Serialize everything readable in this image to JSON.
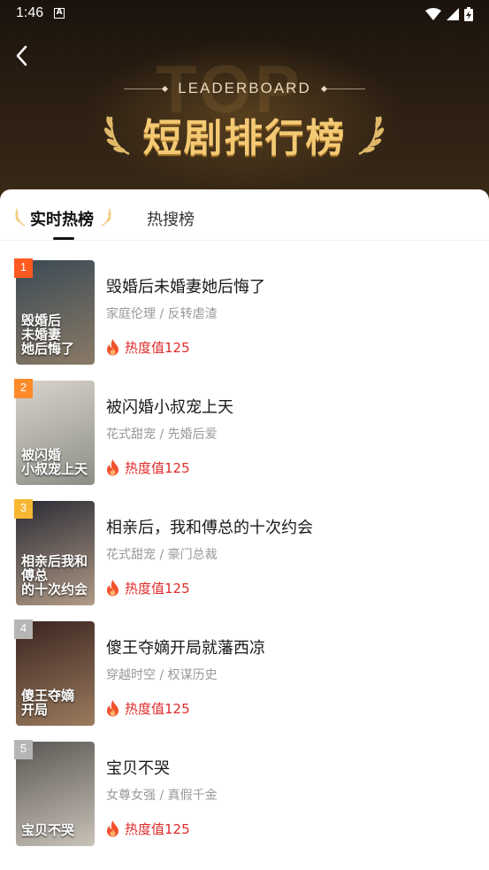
{
  "status_bar": {
    "time": "1:46",
    "notification_letter": "A"
  },
  "header": {
    "watermark": "TOP",
    "subtitle": "LEADERBOARD",
    "title": "短剧排行榜"
  },
  "tabs": [
    {
      "label": "实时热榜",
      "active": true
    },
    {
      "label": "热搜榜",
      "active": false
    }
  ],
  "items": [
    {
      "rank": "1",
      "title": "毁婚后未婚妻她后悔了",
      "tags": "家庭伦理 / 反转虐渣",
      "heat": "热度值125",
      "poster_text": "毁婚后\n未婚妻\n她后悔了",
      "badge_color": "#ff5a1f",
      "poster_colors": [
        "#3a4a55",
        "#8a7a66"
      ]
    },
    {
      "rank": "2",
      "title": "被闪婚小叔宠上天",
      "tags": "花式甜宠 / 先婚后爱",
      "heat": "热度值125",
      "poster_text": "被闪婚\n小叔宠上天",
      "badge_color": "#ff8a2a",
      "poster_colors": [
        "#d9d3cc",
        "#8c8f86"
      ]
    },
    {
      "rank": "3",
      "title": "相亲后，我和傅总的十次约会",
      "tags": "花式甜宠 / 豪门总裁",
      "heat": "热度值125",
      "poster_text": "相亲后我和傅总\n的十次约会",
      "badge_color": "#f7b733",
      "poster_colors": [
        "#2b2b35",
        "#b09a86"
      ]
    },
    {
      "rank": "4",
      "title": "傻王夺嫡开局就藩西凉",
      "tags": "穿越时空 / 权谋历史",
      "heat": "热度值125",
      "poster_text": "傻王夺嫡\n开局",
      "badge_color": "#b5b5b5",
      "poster_colors": [
        "#3b2420",
        "#9a7b5e"
      ]
    },
    {
      "rank": "5",
      "title": "宝贝不哭",
      "tags": "女尊女强 / 真假千金",
      "heat": "热度值125",
      "poster_text": "宝贝不哭",
      "badge_color": "#b5b5b5",
      "poster_colors": [
        "#5c5753",
        "#c8c2b8"
      ]
    }
  ],
  "colors": {
    "accent_gold": "#f4c974",
    "heat_red": "#e02a2a"
  }
}
